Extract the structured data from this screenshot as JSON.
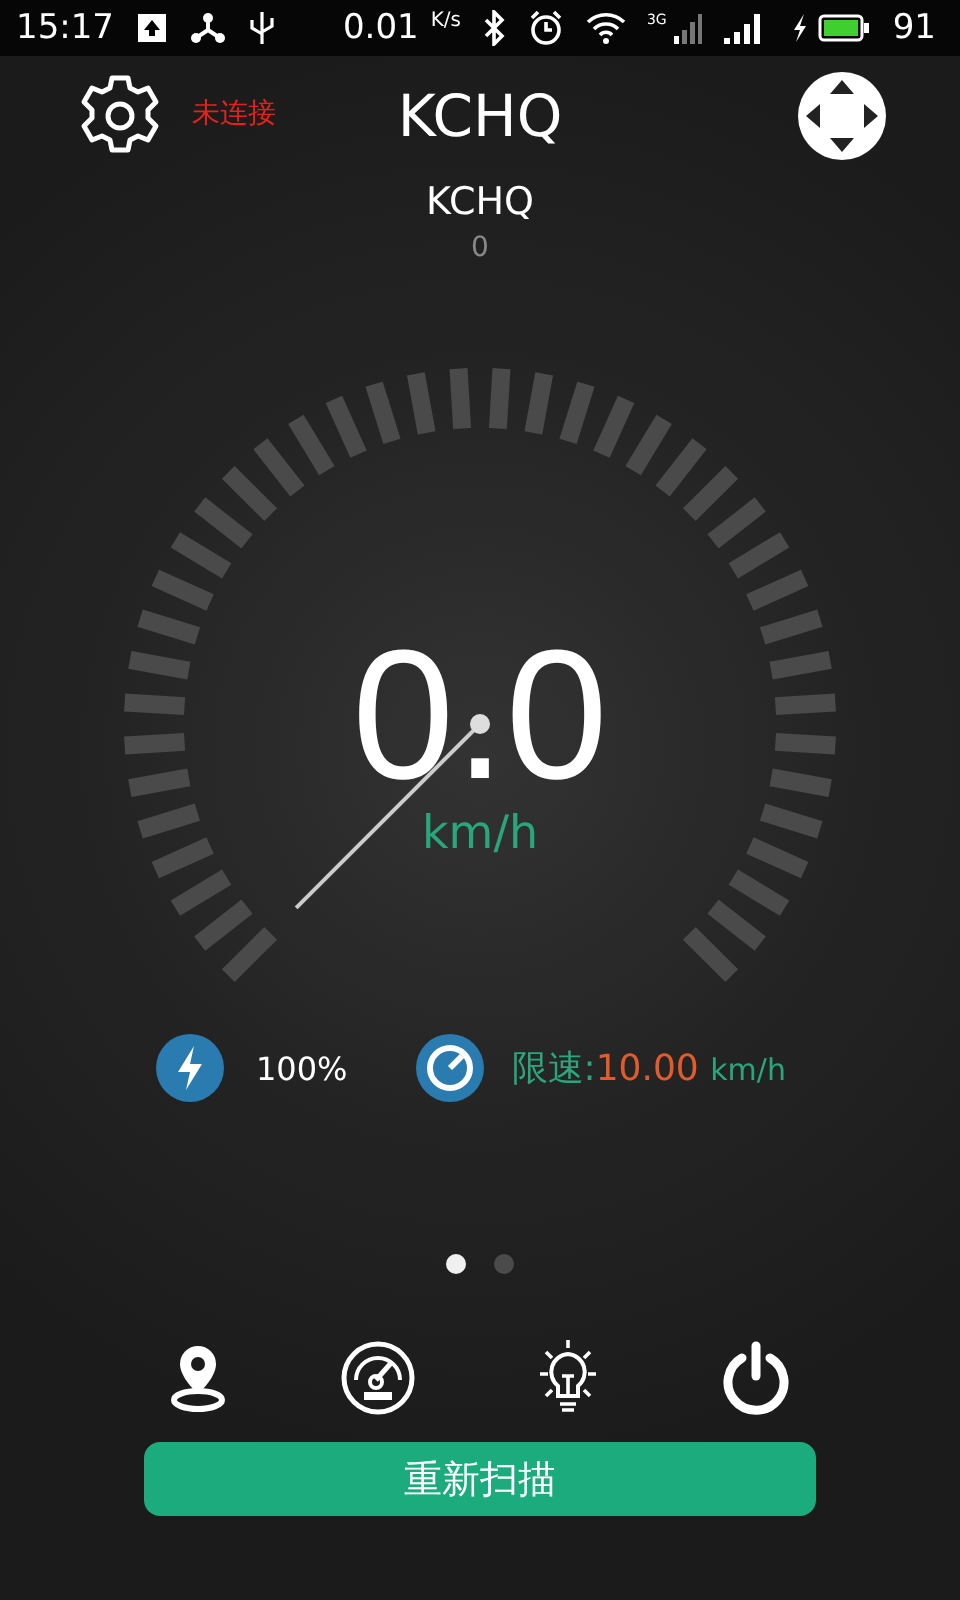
{
  "status_bar": {
    "time": "15:17",
    "net_speed": "0.01",
    "net_unit": "K/s",
    "network_type": "3G",
    "battery": "91"
  },
  "header": {
    "connection_status": "未连接",
    "title": "KCHQ"
  },
  "device": {
    "name": "KCHQ",
    "value": "0"
  },
  "speedometer": {
    "speed": "0.0",
    "unit": "km/h"
  },
  "info": {
    "battery": "100%",
    "limit_label": "限速:",
    "limit_value": "10.00",
    "limit_unit": "km/h"
  },
  "pages": [
    {
      "selected": true
    },
    {
      "selected": false
    }
  ],
  "toolbar": [
    {
      "kind": "location"
    },
    {
      "kind": "gauge"
    },
    {
      "kind": "light"
    },
    {
      "kind": "power"
    }
  ],
  "rescan_button": "重新扫描"
}
